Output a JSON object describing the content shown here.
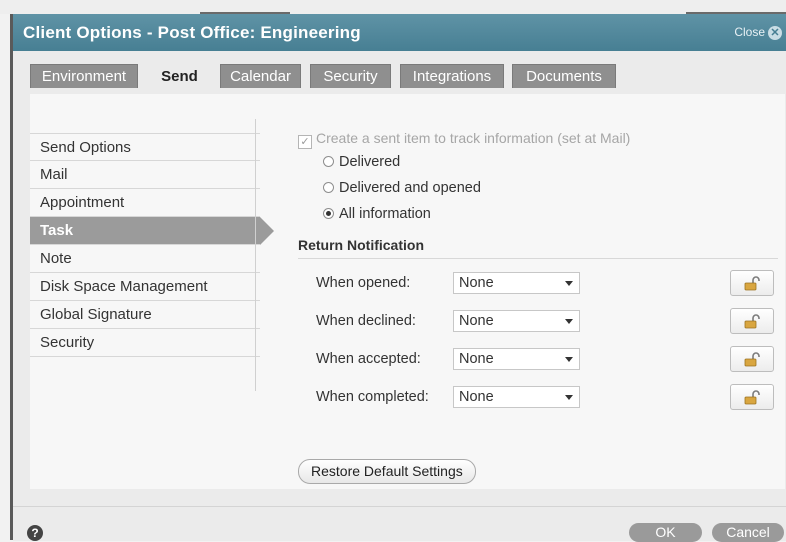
{
  "dialog": {
    "title": "Client Options - Post Office: Engineering",
    "close_label": "Close",
    "close_glyph": "✕"
  },
  "tabs": [
    {
      "label": "Environment",
      "active": false
    },
    {
      "label": "Send",
      "active": true
    },
    {
      "label": "Calendar",
      "active": false
    },
    {
      "label": "Security",
      "active": false
    },
    {
      "label": "Integrations",
      "active": false
    },
    {
      "label": "Documents",
      "active": false
    }
  ],
  "nav": {
    "items": [
      {
        "label": "Send Options"
      },
      {
        "label": "Mail"
      },
      {
        "label": "Appointment"
      },
      {
        "label": "Task",
        "selected": true
      },
      {
        "label": "Note"
      },
      {
        "label": "Disk Space Management"
      },
      {
        "label": "Global Signature"
      },
      {
        "label": "Security"
      }
    ]
  },
  "task": {
    "sent_item_checkbox": {
      "label": "Create a sent item to track information (set at Mail)",
      "checked": true,
      "disabled": true,
      "check_glyph": "✓"
    },
    "radios": [
      {
        "label": "Delivered",
        "selected": false
      },
      {
        "label": "Delivered and opened",
        "selected": false
      },
      {
        "label": "All information",
        "selected": true
      }
    ],
    "return_notification": {
      "heading": "Return Notification",
      "rows": [
        {
          "label": "When opened:",
          "value": "None"
        },
        {
          "label": "When declined:",
          "value": "None"
        },
        {
          "label": "When accepted:",
          "value": "None"
        },
        {
          "label": "When completed:",
          "value": "None"
        }
      ]
    },
    "restore_label": "Restore Default Settings"
  },
  "footer": {
    "help_glyph": "?",
    "ok_label": "OK",
    "cancel_label": "Cancel"
  },
  "colors": {
    "titlebar": "#4f889c",
    "tab_inactive": "#8f8f8f",
    "nav_selected": "#9b9b9b",
    "lock": "#d9a640"
  }
}
